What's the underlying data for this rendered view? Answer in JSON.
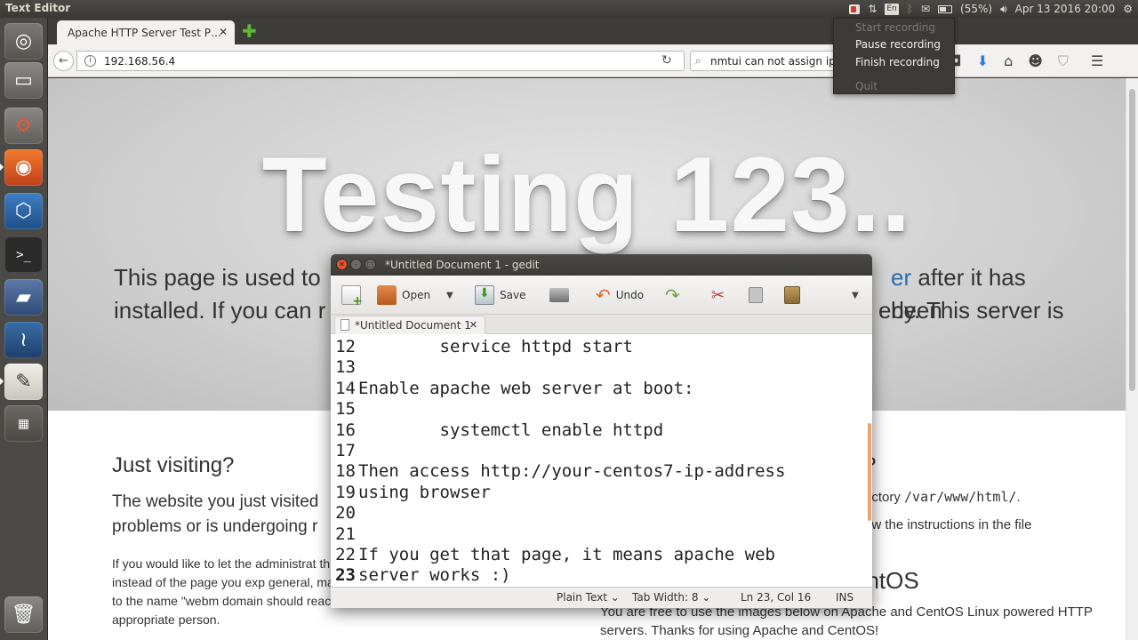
{
  "top_panel": {
    "app_title": "Text Editor",
    "keyboard_layout": "En",
    "battery": "(55%)",
    "datetime": "Apr 13 2016 20:00"
  },
  "recording_menu": {
    "items": [
      "Start recording",
      "Pause recording",
      "Finish recording",
      "Quit"
    ]
  },
  "launcher": {
    "icons": [
      "ubuntu-dash-icon",
      "files-icon",
      "system-settings-icon",
      "firefox-icon",
      "virtualbox-icon",
      "terminal-icon",
      "disk-icon",
      "mysql-workbench-icon",
      "text-editor-icon",
      "workspace-switcher-icon",
      "trash-icon"
    ]
  },
  "firefox": {
    "tab_title": "Apache HTTP Server Test P…",
    "url": "192.168.56.4",
    "search_text": "nmtui can not assign ip ad",
    "page": {
      "hero_title": "Testing 123..",
      "hero_line1_left": "This page is used to",
      "hero_line1_accent": "er",
      "hero_line1_right": "after it has been",
      "hero_line2_left": "installed. If you can r",
      "hero_line2_right": "erly. This server is",
      "just_visiting": "Just visiting?",
      "visit_p1": "The website you just visited problems or is undergoing r",
      "visit_p2": "If you would like to let the administrat this page instead of the page you exp general, mail sent to the name \"webm domain should reach the appropriate person.",
      "right_heading": "?",
      "right_p1_pre": "ectory ",
      "right_p1_code": "/var/www/html/",
      "right_p1_post": ".",
      "right_p2": "ow the instructions in the file",
      "right_h2": "entOS",
      "right_p3": "You are free to use the images below on Apache and CentOS Linux powered HTTP servers. Thanks for using Apache and CentOS!"
    }
  },
  "gedit": {
    "window_title": "*Untitled Document 1 - gedit",
    "toolbar": {
      "open": "Open",
      "save": "Save",
      "undo": "Undo"
    },
    "tab_label": "*Untitled Document 1",
    "lines": [
      {
        "n": "12",
        "text": "        service httpd start"
      },
      {
        "n": "13",
        "text": ""
      },
      {
        "n": "14",
        "text": "Enable apache web server at boot:"
      },
      {
        "n": "15",
        "text": ""
      },
      {
        "n": "16",
        "text": "        systemctl enable httpd"
      },
      {
        "n": "17",
        "text": ""
      },
      {
        "n": "18",
        "text": "Then access http://your-centos7-ip-address"
      },
      {
        "n": "19",
        "text": "using browser"
      },
      {
        "n": "20",
        "text": ""
      },
      {
        "n": "21",
        "text": ""
      },
      {
        "n": "22",
        "text": "If you get that page, it means apache web"
      },
      {
        "n": "23",
        "text": "server works :)"
      }
    ],
    "status": {
      "language": "Plain Text",
      "tab_width": "Tab Width: 8",
      "position": "Ln 23, Col 16",
      "mode": "INS"
    }
  }
}
